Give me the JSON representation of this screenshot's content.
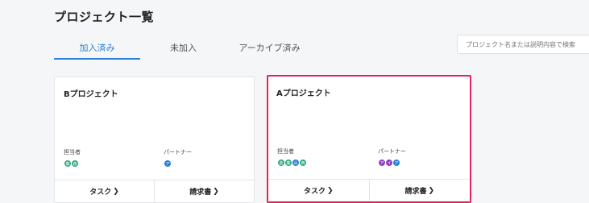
{
  "header": {
    "title": "プロジェクト一覧"
  },
  "tabs": [
    {
      "label": "加入済み",
      "active": true
    },
    {
      "label": "未加入",
      "active": false
    },
    {
      "label": "アーカイブ済み",
      "active": false
    }
  ],
  "search": {
    "placeholder": "プロジェクト名または説明内容で検索"
  },
  "cards": [
    {
      "title": "Bプロジェクト",
      "assignee_label": "担当者",
      "partner_label": "パートナー",
      "assignees": [
        {
          "initial": "藤",
          "color": "#2ea87a"
        },
        {
          "initial": "森",
          "color": "#2ea87a"
        }
      ],
      "partners": [
        {
          "initial": "ア",
          "color": "#2a7fd4"
        }
      ],
      "task_label": "タスク",
      "invoice_label": "請求書",
      "highlighted": false
    },
    {
      "title": "Aプロジェクト",
      "assignee_label": "担当者",
      "partner_label": "パートナー",
      "assignees": [
        {
          "initial": "金",
          "color": "#2ea87a"
        },
        {
          "initial": "藤",
          "color": "#2ea87a"
        },
        {
          "initial": "山",
          "color": "#2a7fd4"
        },
        {
          "initial": "西",
          "color": "#2ea87a"
        }
      ],
      "partners": [
        {
          "initial": "ア",
          "color": "#8e3fc4"
        },
        {
          "initial": "イ",
          "color": "#8e3fc4"
        },
        {
          "initial": "ア",
          "color": "#2a7fd4"
        }
      ],
      "task_label": "タスク",
      "invoice_label": "請求書",
      "highlighted": true
    }
  ],
  "icons": {
    "chevron": "chevron-right-icon"
  }
}
